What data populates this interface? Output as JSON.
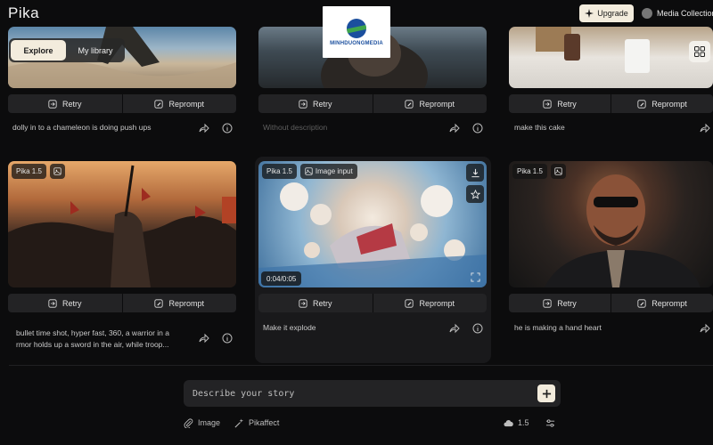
{
  "app": {
    "logo": "Pika"
  },
  "header": {
    "upgrade_label": "Upgrade",
    "collection_label": "Media Collection"
  },
  "watermark": {
    "text": "MINHDUONGMEDIA"
  },
  "view_toggle": {
    "explore": "Explore",
    "library": "My library"
  },
  "actions": {
    "retry": "Retry",
    "reprompt": "Reprompt"
  },
  "cards": [
    {
      "caption": "dolly in to a chameleon is doing push ups"
    },
    {
      "caption": "Without description"
    },
    {
      "caption": "make this cake"
    },
    {
      "tag": "Pika 1.5",
      "caption_line1": "bullet time shot, hyper fast, 360, a warrior in a",
      "caption_line2": "rmor holds up a sword in the air, while troop..."
    },
    {
      "tag": "Pika 1.5",
      "tag2": "Image input",
      "duration": "0:04/0:05",
      "caption": "Make it explode"
    },
    {
      "tag": "Pika 1.5",
      "caption": "he is making a hand heart"
    }
  ],
  "prompt": {
    "placeholder": "Describe your story"
  },
  "toolbar": {
    "image_label": "Image",
    "pikaffect_label": "Pikaffect",
    "model_version": "1.5"
  },
  "icons": {
    "retry": "retry-icon",
    "reprompt": "reprompt-icon",
    "share": "share-icon",
    "info": "info-icon"
  },
  "colors": {
    "background": "#0c0c0d",
    "button": "#232325",
    "accent": "#f3ecdd"
  }
}
